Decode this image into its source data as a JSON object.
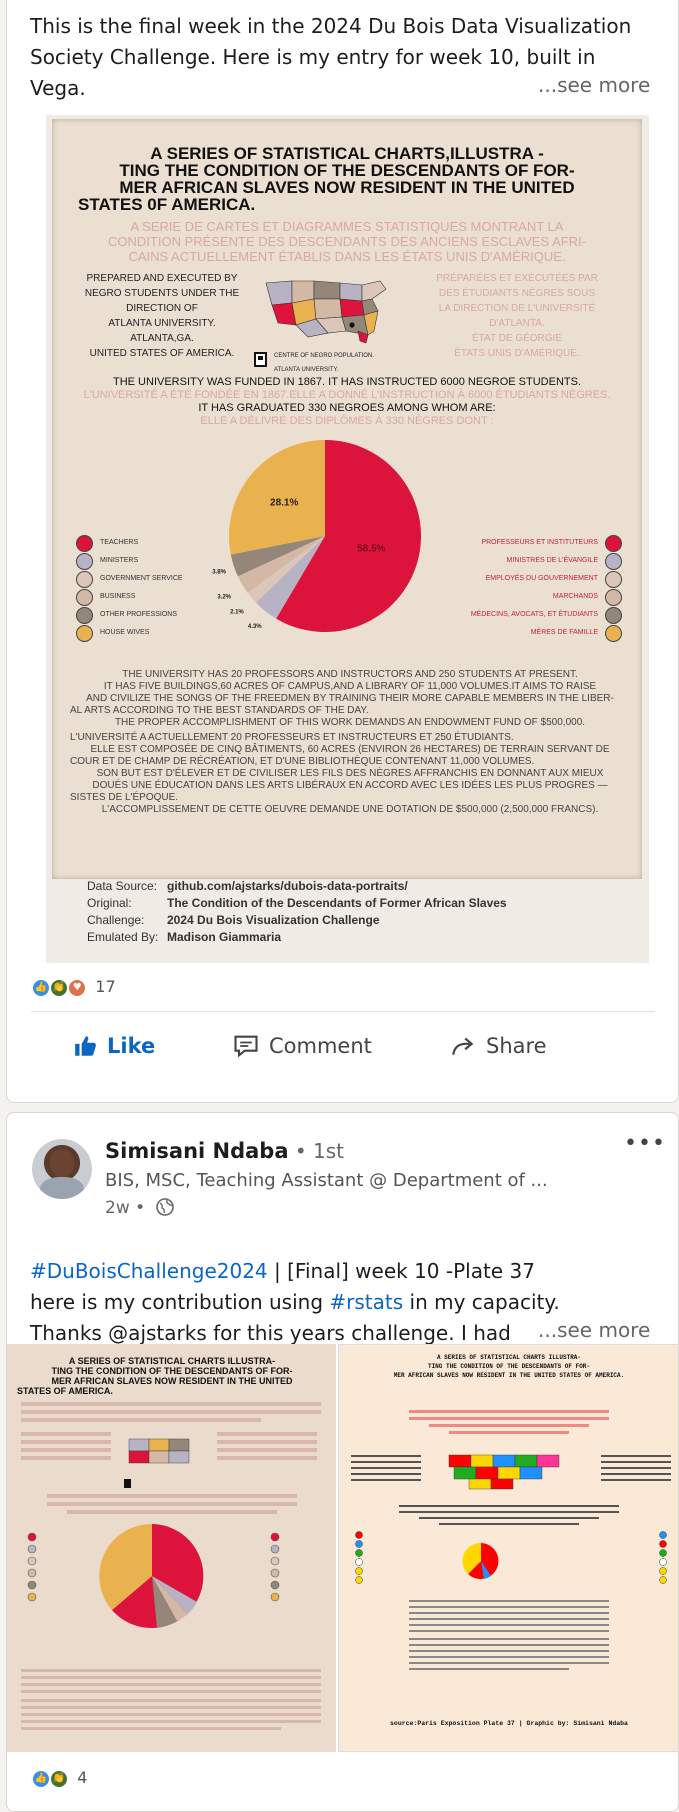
{
  "post1": {
    "text_line1": "This is the final week in the 2024 Du Bois Data Visualization",
    "text_line2": "Society Challenge. Here is my entry for week 10, built in",
    "text_line3": "Vega.",
    "see_more": "...see more",
    "poster": {
      "title_en_1": "A SERIES OF STATISTICAL CHARTS,ILLUSTRA -",
      "title_en_2": "TING THE CONDITION OF THE DESCENDANTS OF FOR-",
      "title_en_3": "MER AFRICAN SLAVES NOW RESIDENT IN THE UNITED",
      "title_en_4": "STATES 0F AMERICA.",
      "title_fr_1": "A SERIE DE CARTES ET DIAGRAMMES STATISTIQUES MONTRANT LA",
      "title_fr_2": "CONDITION PRÉSENTE DES DESCENDANTS DES ANCIENS ESCLAVES AFRI-",
      "title_fr_3": "CAINS ACTUELLEMENT ÉTABLIS DANS LES ÉTATS UNIS D'AMÉRIQUE.",
      "prep_en_1": "PREPARED AND EXECUTED BY",
      "prep_en_2": "NEGRO STUDENTS UNDER THE",
      "prep_en_3": "DIRECTION OF",
      "prep_en_4": "ATLANTA UNIVERSITY.",
      "prep_en_5": "ATLANTA,GA.",
      "prep_en_6": "UNITED STATES OF AMERICA.",
      "prep_fr_1": "PRÉPARÉES ET EXÉCUTÉES PAR",
      "prep_fr_2": "DES ÉTUDIANTS NÈGRES SOUS",
      "prep_fr_3": "LA DIRECTION DE L'UNIVERSITÉ",
      "prep_fr_4": "D'ATLANTA.",
      "prep_fr_5": "ÉTAT DE GÉORGIE",
      "prep_fr_6": "ÉTATS UNIS D'AMÉRIQUE.",
      "map_label_1": "CENTRE OF NEGRO POPULATION.",
      "map_label_2": "ATLANTA UNIVERSITY.",
      "funded_en": "THE UNIVERSITY WAS FUNDED IN 1867. IT HAS INSTRUCTED 6000 NEGROE STUDENTS.",
      "funded_fr": "L'UNIVERSITÉ A ÉTÉ FONDÉE EN 1867.ELLE A DONNÉ L'INSTRUCTION À 6000 ÉTUDIANTS NÈGRES.",
      "graduated_en": "IT HAS GRADUATED 330 NEGROES AMONG WHOM ARE:",
      "graduated_fr": "ELLE A DÉLIVRÉ DES DIPLÔMES À 330 NÈGRES DONT :",
      "body_en_1": "THE UNIVERSITY HAS 20 PROFESSORS AND INSTRUCTORS AND 250 STUDENTS AT PRESENT.",
      "body_en_2": "IT HAS FIVE BUILDINGS,60 ACRES OF CAMPUS,AND A LIBRARY OF 11,000 VOLUMES.IT AIMS TO RAISE",
      "body_en_3": "AND CIVILIZE THE SONGS OF THE FREEDMEN BY TRAINING THEIR MORE CAPABLE MEMBERS IN THE LIBER-",
      "body_en_4": "AL ARTS ACCORDING TO THE BEST STANDARDS OF THE DAY.",
      "body_en_5": "THE PROPER ACCOMPLISHMENT OF THIS WORK DEMANDS AN ENDOWMENT FUND OF $500,000.",
      "body_fr_1": "L'UNIVERSITÉ A ACTUELLEMENT 20 PROFESSEURS ET INSTRUCTEURS ET 250 ÉTUDIANTS.",
      "body_fr_2": "ELLE EST COMPOSÉE DE CINQ BÂTIMENTS, 60 ACRES (ENVIRON 26 HECTARES) DE TERRAIN SERVANT DE",
      "body_fr_3": "COUR ET DE CHAMP DE RÉCRÉATION, ET D'UNE BIBLIOTHÈQUE CONTENANT 11,000 VOLUMES.",
      "body_fr_4": "SON BUT EST D'ÉLEVER ET DE CIVILISER LES FILS DES NÈGRES AFFRANCHIS EN DONNANT AUX MIEUX",
      "body_fr_5": "DOUÉS UNE ÉDUCATION DANS LES ARTS LIBÉRAUX EN ACCORD AVEC LES IDÉES LES PLUS PROGRES —",
      "body_fr_6": "SISTES DE L'ÉPOQUE.",
      "body_fr_7": "L'ACCOMPLISSEMENT DE CETTE OEUVRE DEMANDE UNE DOTATION DE $500,000 (2,500,000 FRANCS).",
      "legend_en": [
        "TEACHERS",
        "MINISTERS",
        "GOVERNMENT SERVICE",
        "BUSINESS",
        "OTHER PROFESSIONS",
        "HOUSE WIVES"
      ],
      "legend_fr": [
        "PROFESSEURS ET INSTITUTEURS",
        "MINISTRES DE L'ÉVANGILE",
        "EMPLOYÉS DU GOUVERNEMENT",
        "MARCHANDS",
        "MÉDECINS, AVOCATS, ET ÉTUDIANTS",
        "MÈRES DE FAMILLE"
      ],
      "legend_colors": [
        "#dc143c",
        "#b7b3c5",
        "#dcc6b9",
        "#d3b9a5",
        "#94877a",
        "#eab14f"
      ]
    },
    "meta": {
      "source_label": "Data Source:",
      "source_value": "github.com/ajstarks/dubois-data-portraits/",
      "original_label": "Original:",
      "original_value": "The Condition of the Descendants of Former African Slaves",
      "challenge_label": "Challenge:",
      "challenge_value": "2024 Du Bois Visualization Challenge",
      "emulated_label": "Emulated By:",
      "emulated_value": "Madison Giammaria"
    },
    "reaction_count": "17",
    "like": "Like",
    "comment": "Comment",
    "share": "Share"
  },
  "post2": {
    "author": "Simisani Ndaba",
    "degree": " • 1st",
    "headline": "BIS, MSC, Teaching Assistant @ Department of ...",
    "time": "2w •",
    "hashtag_1": "#DuBoisChallenge2024",
    "line1_rest": " | [Final] week 10 -Plate 37",
    "line2_pre": "here is my contribution using ",
    "hashtag_2": "#rstats",
    "line2_post": " in my capacity.",
    "line3": "Thanks @ajstarks for this years challenge. I had",
    "see_more": "...see more",
    "img_b_title_1": "A SERIES OF STATISTICAL CHARTS ILLUSTRA-",
    "img_b_title_2": "TING THE CONDITION OF THE DESCENDANTS OF FOR-",
    "img_b_title_3": "MER AFRICAN SLAVES NOW RESIDENT IN THE UNITED STATES OF AMERICA.",
    "img_b_source": "source:Paris Exposition Plate 37 | Graphic by: Simisani Ndaba",
    "img_a_title_1": "A SERIES OF STATISTICAL CHARTS ILLUSTRA-",
    "img_a_title_2": "TING THE CONDITION OF THE DESCENDANTS OF FOR-",
    "img_a_title_3": "MER AFRICAN SLAVES NOW RESIDENT IN THE UNITED",
    "img_a_title_4": "STATES OF AMERICA.",
    "reaction_count": "4"
  },
  "chart_data": [
    {
      "type": "pie",
      "title": "",
      "categories": [
        "TEACHERS",
        "MINISTERS",
        "GOVERNMENT SERVICE",
        "BUSINESS",
        "OTHER PROFESSIONS",
        "HOUSE WIVES"
      ],
      "values": [
        58.5,
        4.3,
        2.1,
        3.2,
        3.8,
        28.1
      ],
      "labels": [
        "58.5%",
        "4.3%",
        "2.1%",
        "3.2%",
        "3.8%",
        "28.1%"
      ],
      "colors": [
        "#dc143c",
        "#b7b3c5",
        "#dcc6b9",
        "#d3b9a5",
        "#94877a",
        "#eab14f"
      ]
    }
  ]
}
